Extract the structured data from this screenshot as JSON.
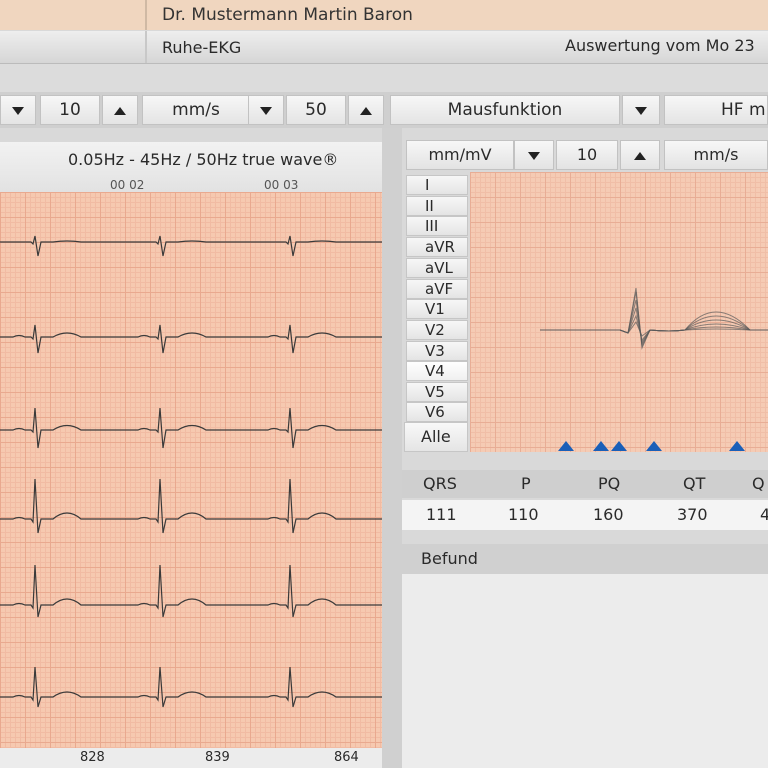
{
  "header": {
    "patient_name": "Dr. Mustermann Martin Baron",
    "exam_type": "Ruhe-EKG",
    "evaluation_date": "Auswertung vom Mo 23"
  },
  "toolbar": {
    "sens_value": "10",
    "speed_unit": "mm/s",
    "speed_value": "50",
    "mouse_function": "Mausfunktion",
    "hf_label": "HF m"
  },
  "left_panel": {
    "filter_text": "0.05Hz - 45Hz / 50Hz true wave®",
    "time_marks": [
      "00 02",
      "00 03"
    ],
    "footer_values": [
      "828",
      "839",
      "864"
    ]
  },
  "right_panel": {
    "sens_unit": "mm/mV",
    "sens_value": "10",
    "speed_unit": "mm/s",
    "leads": [
      "I",
      "II",
      "III",
      "aVR",
      "aVL",
      "aVF",
      "V1",
      "V2",
      "V3",
      "V4",
      "V5",
      "V6"
    ],
    "all_leads_button": "Alle"
  },
  "measurements": {
    "headers": [
      "QRS",
      "P",
      "PQ",
      "QT",
      "Q"
    ],
    "values": [
      "111",
      "110",
      "160",
      "370",
      "4"
    ]
  },
  "findings": {
    "label": "Befund"
  },
  "colors": {
    "grid_background": "#f6c9b0",
    "trace": "#3a3a3a",
    "marker": "#1a5fb8"
  }
}
